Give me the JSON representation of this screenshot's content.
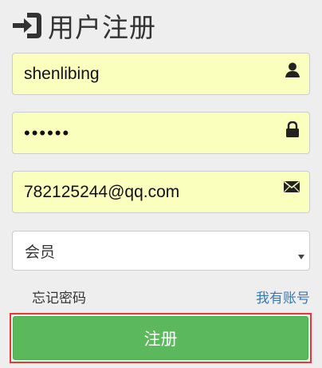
{
  "header": {
    "title": "用户注册",
    "icon": "sign-in-icon"
  },
  "form": {
    "username": {
      "value": "shenlibing",
      "icon": "user-icon"
    },
    "password": {
      "value": "••••••",
      "icon": "lock-icon"
    },
    "email": {
      "value": "782125244@qq.com",
      "icon": "envelope-icon"
    },
    "role_select": {
      "selected": "会员",
      "icon": "caret-down-icon"
    },
    "forgot_password_label": "忘记密码",
    "have_account_label": "我有账号",
    "submit_label": "注册"
  },
  "colors": {
    "autofill_background": "#faffbd",
    "submit_green": "#5cb85c",
    "link_blue": "#3a79b4",
    "highlight_red": "#e53935"
  }
}
